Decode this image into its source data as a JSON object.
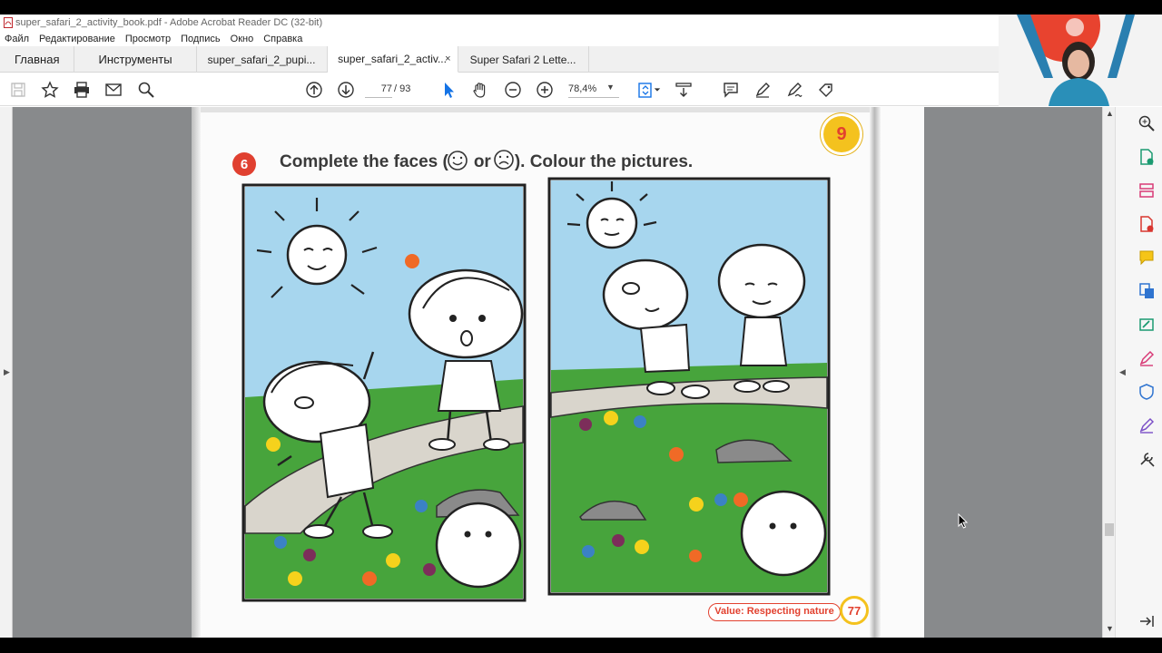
{
  "window": {
    "title": "super_safari_2_activity_book.pdf - Adobe Acrobat Reader DC (32-bit)"
  },
  "menu": [
    "Файл",
    "Редактирование",
    "Просмотр",
    "Подпись",
    "Окно",
    "Справка"
  ],
  "tabs": {
    "home": "Главная",
    "tools": "Инструменты",
    "docs": [
      {
        "label": "super_safari_2_pupi...",
        "active": false
      },
      {
        "label": "super_safari_2_activ...",
        "active": true,
        "close": "×"
      },
      {
        "label": "Super Safari 2 Lette...",
        "active": false
      }
    ]
  },
  "toolbar": {
    "current_page": "77",
    "total_pages": "/ 93",
    "zoom": "78,4%"
  },
  "document_page": {
    "unit_badge": "9",
    "activity_number": "6",
    "instruction_part1": "Complete the faces (",
    "instruction_or": "or",
    "instruction_part2": "). Colour the pictures.",
    "value_label": "Value: Respecting nature",
    "page_number": "77"
  },
  "colors": {
    "accent_red": "#e2412f",
    "badge_yellow": "#f4c21e",
    "sky": "#a7d6ee",
    "grass": "#47a43c",
    "path": "#d9d5cc"
  },
  "icons": [
    "save-icon",
    "star-icon",
    "print-icon",
    "mail-icon",
    "search-icon",
    "arrow-up-icon",
    "arrow-down-icon",
    "select-cursor-icon",
    "hand-icon",
    "zoom-out-icon",
    "zoom-in-icon",
    "fit-page-icon",
    "scroll-mode-icon",
    "comment-icon",
    "pen-icon",
    "sign-icon",
    "share-icon"
  ]
}
